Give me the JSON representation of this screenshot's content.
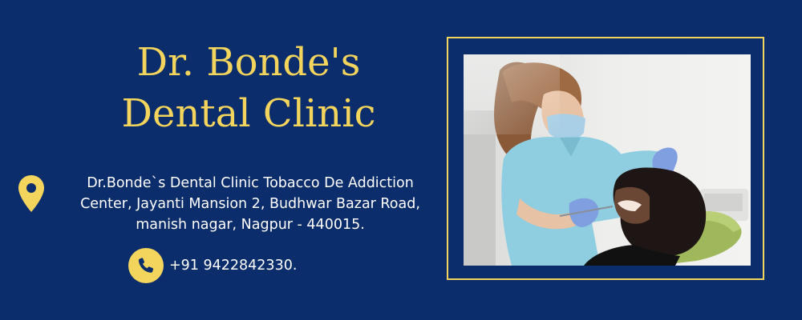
{
  "title": {
    "line1": "Dr. Bonde's",
    "line2": "Dental Clinic"
  },
  "address": {
    "icon": "location-pin-icon",
    "line1": "Dr.Bonde`s Dental Clinic Tobacco De Addiction",
    "line2": "Center, Jayanti Mansion 2, Budhwar Bazar Road,",
    "line3": "manish nagar, Nagpur - 440015."
  },
  "phone": {
    "icon": "phone-icon",
    "number": "+91 9422842330."
  },
  "photo": {
    "subject": "dentist examining patient"
  },
  "colors": {
    "background": "#0b2d6b",
    "accent": "#f3d45c",
    "text": "#ffffff"
  }
}
